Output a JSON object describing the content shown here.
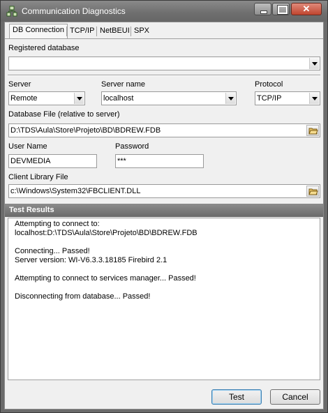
{
  "window": {
    "title": "Communication Diagnostics"
  },
  "tabs": [
    "DB Connection",
    "TCP/IP",
    "NetBEUI",
    "SPX"
  ],
  "form": {
    "registered_db": {
      "label": "Registered database",
      "value": ""
    },
    "server": {
      "label": "Server",
      "value": "Remote"
    },
    "server_name": {
      "label": "Server name",
      "value": "localhost"
    },
    "protocol": {
      "label": "Protocol",
      "value": "TCP/IP"
    },
    "db_file": {
      "label": "Database File (relative to server)",
      "value": "D:\\TDS\\Aula\\Store\\Projeto\\BD\\BDREW.FDB"
    },
    "user_name": {
      "label": "User Name",
      "value": "DEVMEDIA"
    },
    "password": {
      "label": "Password",
      "value": "***"
    },
    "client_lib": {
      "label": "Client Library File",
      "value": "c:\\Windows\\System32\\FBCLIENT.DLL"
    }
  },
  "results": {
    "title": "Test Results",
    "lines": [
      "Attempting to connect to:",
      "localhost:D:\\TDS\\Aula\\Store\\Projeto\\BD\\BDREW.FDB",
      "",
      "Connecting... Passed!",
      "Server version: WI-V6.3.3.18185 Firebird 2.1",
      "",
      "Attempting to connect to services manager... Passed!",
      "",
      "Disconnecting from database... Passed!"
    ]
  },
  "buttons": {
    "test": "Test",
    "cancel": "Cancel"
  },
  "icons": {
    "app": "network-icon",
    "browse": "folder-open-icon"
  }
}
